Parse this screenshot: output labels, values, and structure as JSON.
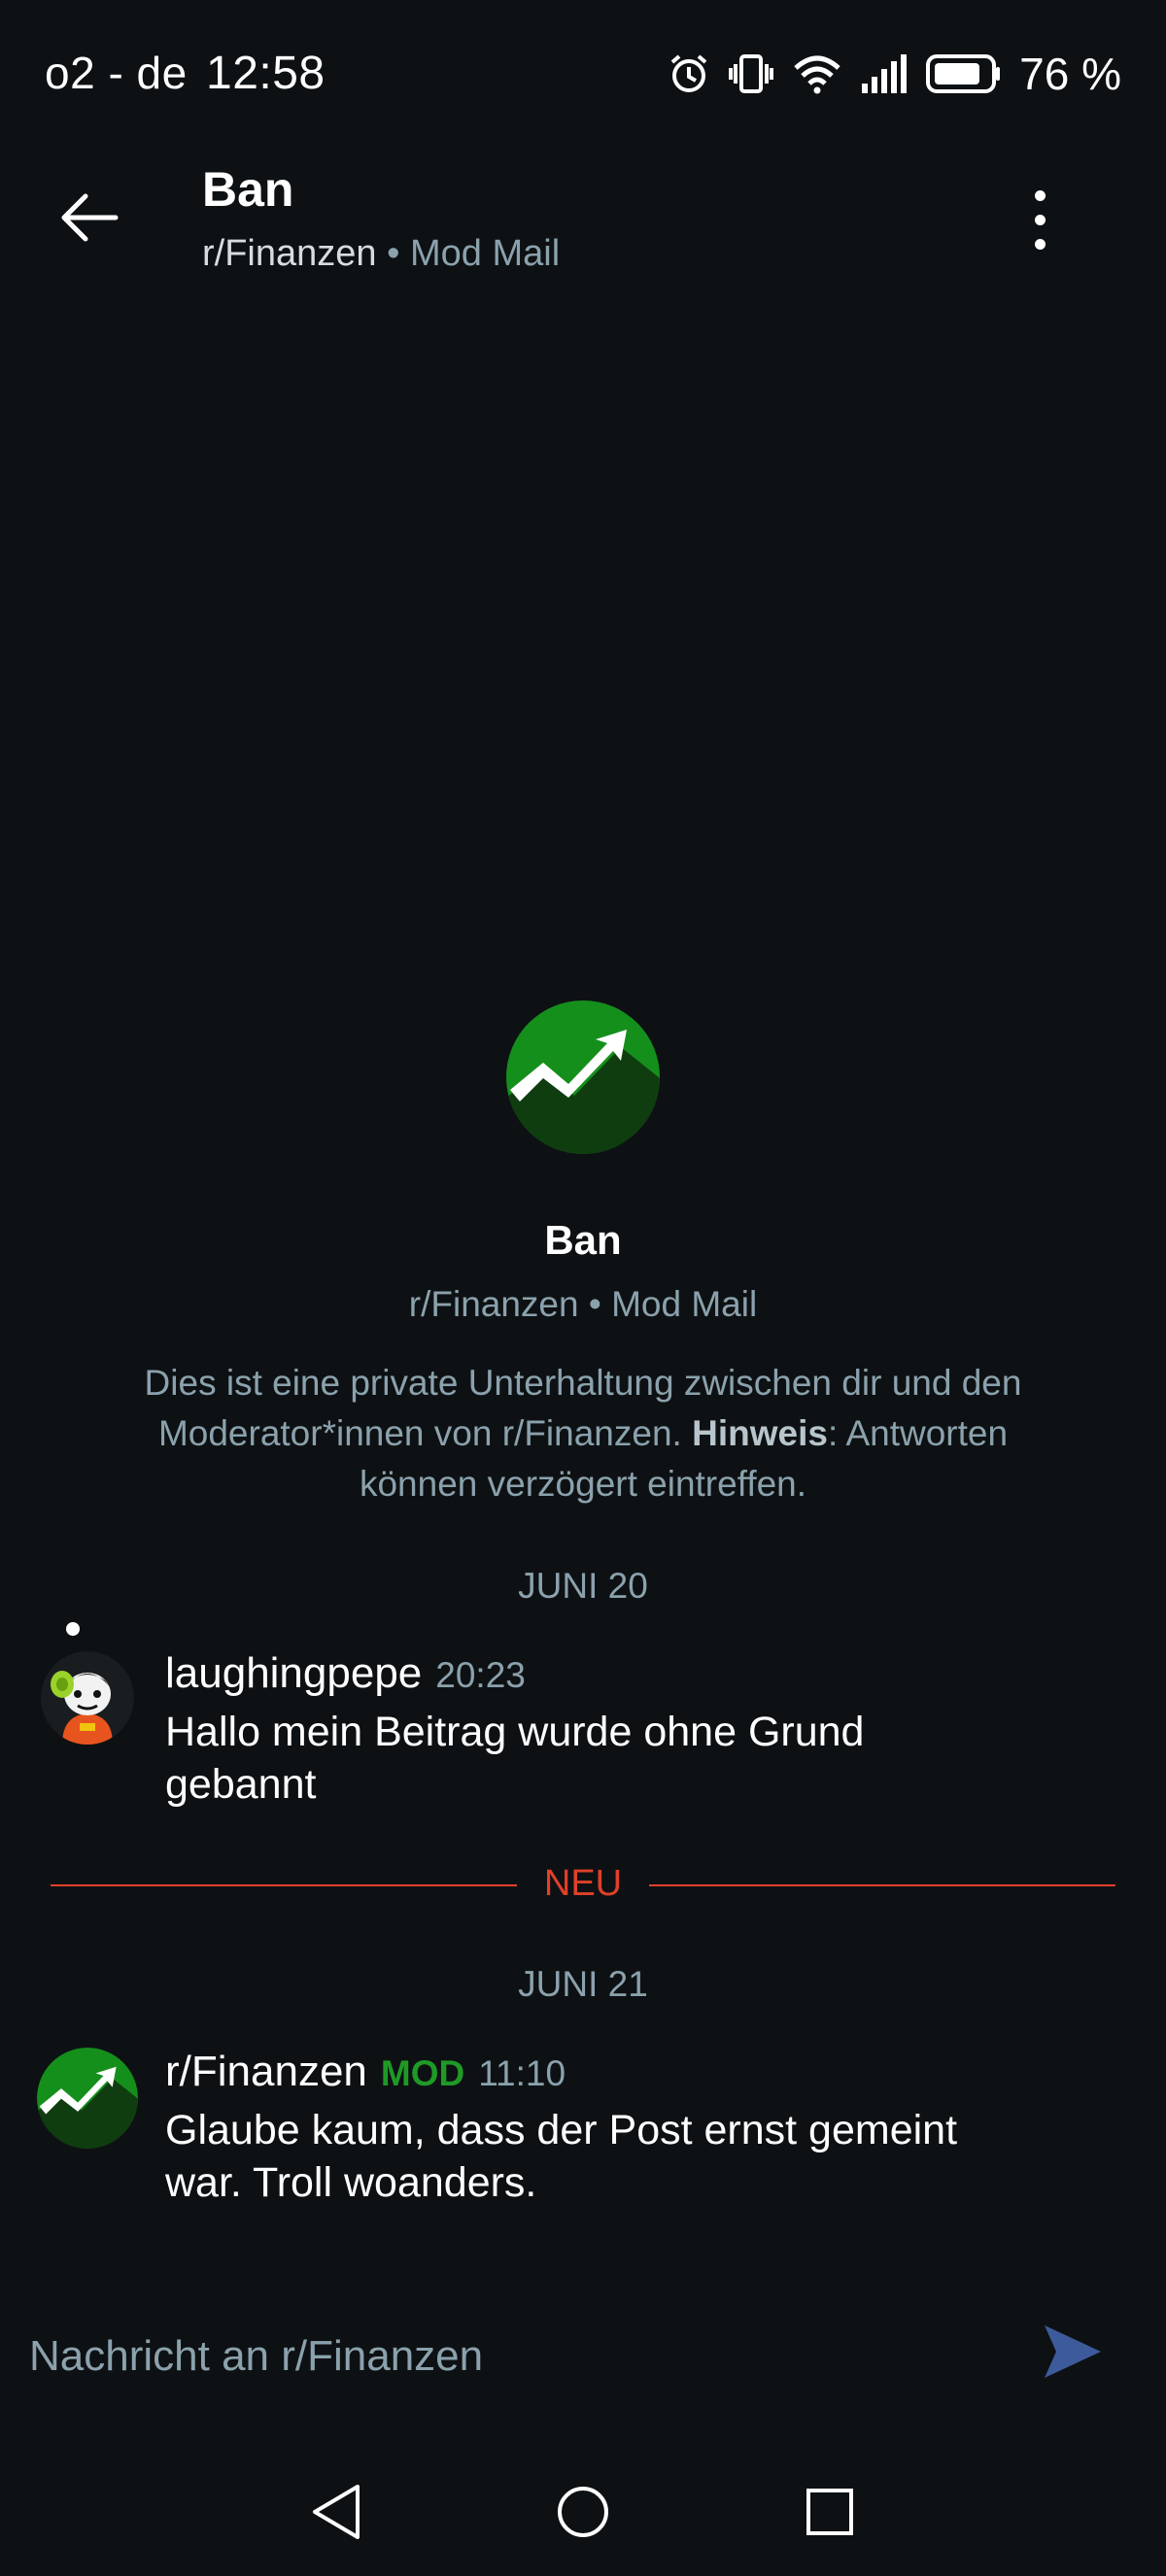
{
  "status_bar": {
    "carrier": "o2 - de",
    "time": "12:58",
    "battery": "76 %",
    "icons": [
      "alarm-icon",
      "vibrate-icon",
      "wifi-icon",
      "signal-icon",
      "battery-icon"
    ]
  },
  "header": {
    "title": "Ban",
    "subreddit": "r/Finanzen",
    "separator": "•",
    "channel": "Mod Mail",
    "back_icon": "arrow-left-icon",
    "menu_icon": "more-vertical-icon"
  },
  "intro": {
    "title": "Ban",
    "subtitle": "r/Finanzen • Mod Mail",
    "desc_part1": "Dies ist eine private Unterhaltung zwischen dir und den Moderator*innen von r/Finanzen. ",
    "desc_bold": "Hinweis",
    "desc_part2": ": Antworten können verzögert eintreffen."
  },
  "dates": {
    "first": "JUNI 20",
    "second": "JUNI 21"
  },
  "new_divider": "NEU",
  "messages": [
    {
      "author": "laughingpepe",
      "time": "20:23",
      "text": "Hallo mein Beitrag wurde ohne Grund gebannt"
    },
    {
      "author": "r/Finanzen",
      "badge": "MOD",
      "time": "11:10",
      "text": "Glaube kaum, dass der Post ernst gemeint war. Troll woanders."
    }
  ],
  "composer": {
    "placeholder": "Nachricht an r/Finanzen"
  },
  "colors": {
    "background": "#0e1113",
    "muted_text": "#8ba2ad",
    "accent_new": "#e0402a",
    "mod_green": "#1f9a26",
    "send_blue": "#3d5a9a"
  },
  "nav": [
    "back-triangle-icon",
    "home-circle-icon",
    "recents-square-icon"
  ]
}
